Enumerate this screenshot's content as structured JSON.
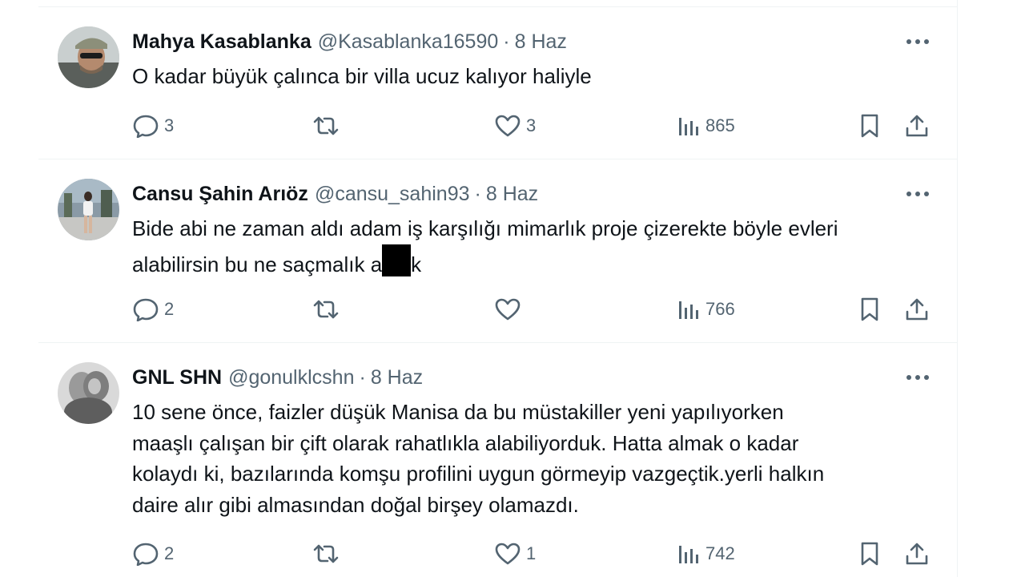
{
  "tweets": [
    {
      "name": "Mahya Kasablanka",
      "handle": "@Kasablanka16590",
      "sep": "·",
      "date": "8 Haz",
      "text_lines": [
        "O kadar büyük çalınca bir villa ucuz kalıyor haliyle"
      ],
      "replies": "3",
      "retweets": "",
      "likes": "3",
      "views": "865"
    },
    {
      "name": "Cansu Şahin Arıöz",
      "handle": "@cansu_sahin93",
      "sep": "·",
      "date": "8 Haz",
      "text_lines": [
        "Bide abi ne zaman aldı adam iş karşılığı mimarlık proje çizerekte böyle evleri",
        "alabilirsin bu ne saçmalık a"
      ],
      "text_tail": "k",
      "replies": "2",
      "retweets": "",
      "likes": "",
      "views": "766"
    },
    {
      "name": "GNL SHN",
      "handle": "@gonulklcshn",
      "sep": "·",
      "date": "8 Haz",
      "text_lines": [
        "10 sene önce, faizler düşük Manisa da bu müstakiller yeni yapılıyorken",
        "maaşlı çalışan bir çift olarak rahatlıkla alabiliyorduk. Hatta almak o kadar",
        "kolaydı ki, bazılarında komşu profilini uygun görmeyip vazgeçtik.yerli halkın",
        "daire alır gibi almasından doğal birşey olamazdı."
      ],
      "replies": "2",
      "retweets": "",
      "likes": "1",
      "views": "742"
    }
  ],
  "icons": {
    "reply": "reply-icon",
    "retweet": "retweet-icon",
    "like": "like-icon",
    "views": "views-icon",
    "bookmark": "bookmark-icon",
    "share": "share-icon",
    "more": "more-icon"
  },
  "colors": {
    "text": "#0f1419",
    "muted": "#536471",
    "divider": "#eff3f4"
  }
}
